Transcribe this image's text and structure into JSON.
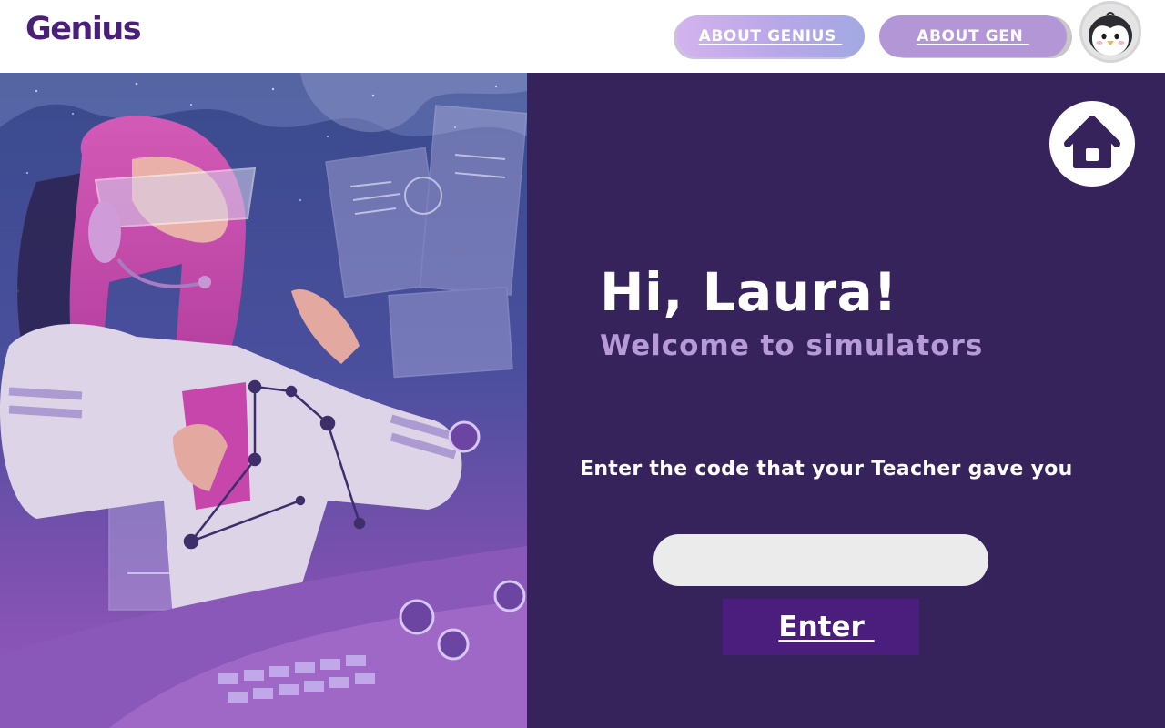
{
  "header": {
    "logo_text": "Genius",
    "nav": [
      {
        "label": "ABOUT GENIUS "
      },
      {
        "label": "ABOUT GEN "
      }
    ],
    "avatar_icon": "penguin-icon"
  },
  "illustration": {
    "subject": "astronaut-girl-at-control-panel-illustration"
  },
  "main": {
    "home_icon": "home-icon",
    "greeting": "Hi, Laura!",
    "welcome": "Welcome to simulators",
    "prompt": "Enter the code that your Teacher gave you",
    "code_input": {
      "value": "",
      "placeholder": ""
    },
    "enter_label": "Enter "
  },
  "colors": {
    "brand": "#4a1f78",
    "panel_bg": "#37235c",
    "subtitle": "#b79ad8",
    "enter_button": "#4b1d7c",
    "input_bg": "#ebebeb"
  }
}
